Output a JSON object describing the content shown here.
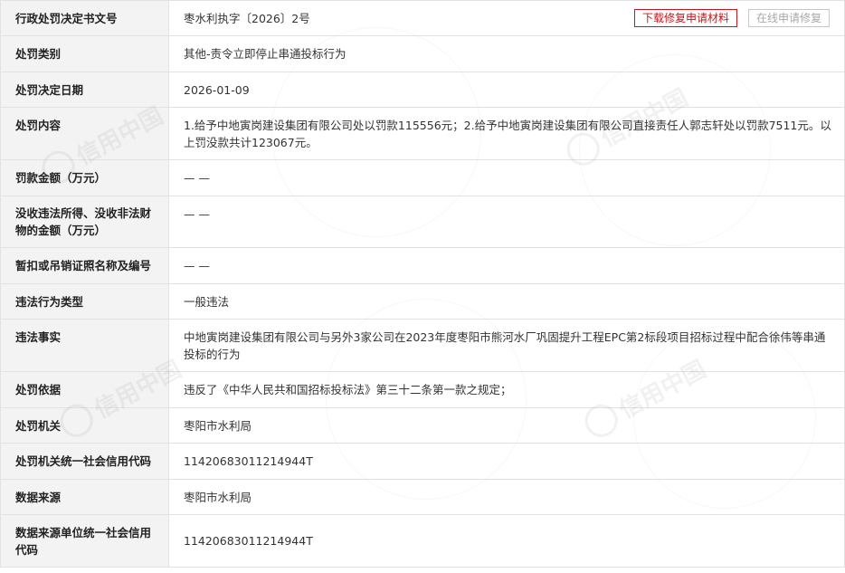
{
  "watermark_text": "信用中国",
  "actions": {
    "download_label": "下载修复申请材料",
    "online_apply_label": "在线申请修复"
  },
  "rows": [
    {
      "label": "行政处罚决定书文号",
      "value": "枣水利执字〔2026〕2号"
    },
    {
      "label": "处罚类别",
      "value": "其他-责令立即停止串通投标行为"
    },
    {
      "label": "处罚决定日期",
      "value": "2026-01-09"
    },
    {
      "label": "处罚内容",
      "value": "1.给予中地寅岗建设集团有限公司处以罚款115556元；2.给予中地寅岗建设集团有限公司直接责任人郭志轩处以罚款7511元。以上罚没款共计123067元。"
    },
    {
      "label": "罚款金额（万元）",
      "value": "— —"
    },
    {
      "label": "没收违法所得、没收非法财物的金额（万元）",
      "value": "— —"
    },
    {
      "label": "暂扣或吊销证照名称及编号",
      "value": "— —"
    },
    {
      "label": "违法行为类型",
      "value": "一般违法"
    },
    {
      "label": "违法事实",
      "value": "中地寅岗建设集团有限公司与另外3家公司在2023年度枣阳市熊河水厂巩固提升工程EPC第2标段项目招标过程中配合徐伟等串通投标的行为"
    },
    {
      "label": "处罚依据",
      "value": "违反了《中华人民共和国招标投标法》第三十二条第一款之规定；"
    },
    {
      "label": "处罚机关",
      "value": "枣阳市水利局"
    },
    {
      "label": "处罚机关统一社会信用代码",
      "value": "11420683011214944T"
    },
    {
      "label": "数据来源",
      "value": "枣阳市水利局"
    },
    {
      "label": "数据来源单位统一社会信用代码",
      "value": "11420683011214944T"
    }
  ]
}
